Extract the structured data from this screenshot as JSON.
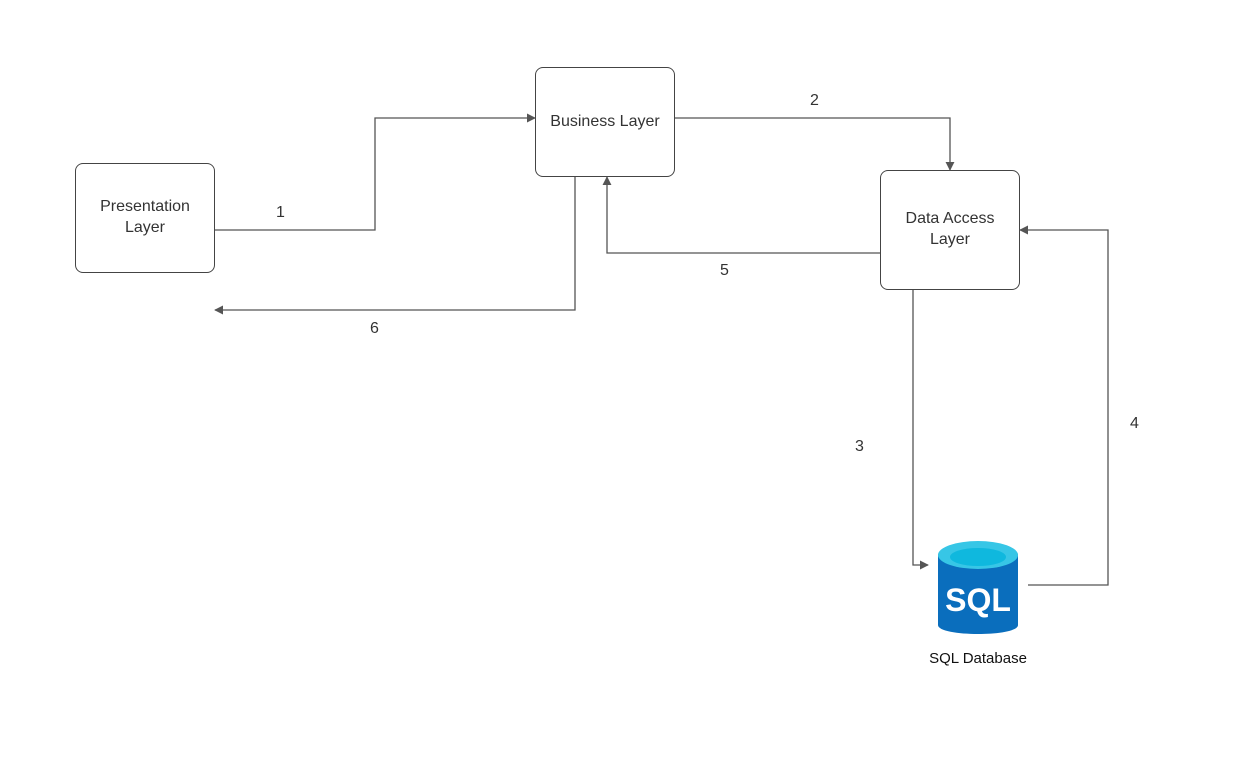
{
  "nodes": {
    "presentation": {
      "label": "Presentation Layer"
    },
    "business": {
      "label": "Business Layer"
    },
    "dataAccess": {
      "label": "Data Access Layer"
    },
    "sqlDb": {
      "label": "SQL Database",
      "iconText": "SQL"
    }
  },
  "edges": {
    "e1": {
      "label": "1"
    },
    "e2": {
      "label": "2"
    },
    "e3": {
      "label": "3"
    },
    "e4": {
      "label": "4"
    },
    "e5": {
      "label": "5"
    },
    "e6": {
      "label": "6"
    }
  },
  "colors": {
    "nodeBorder": "#444444",
    "edge": "#555555",
    "sqlPrimary": "#0a6ebd",
    "sqlTop": "#37c6e6",
    "sqlTopInner": "#0fb8de"
  }
}
